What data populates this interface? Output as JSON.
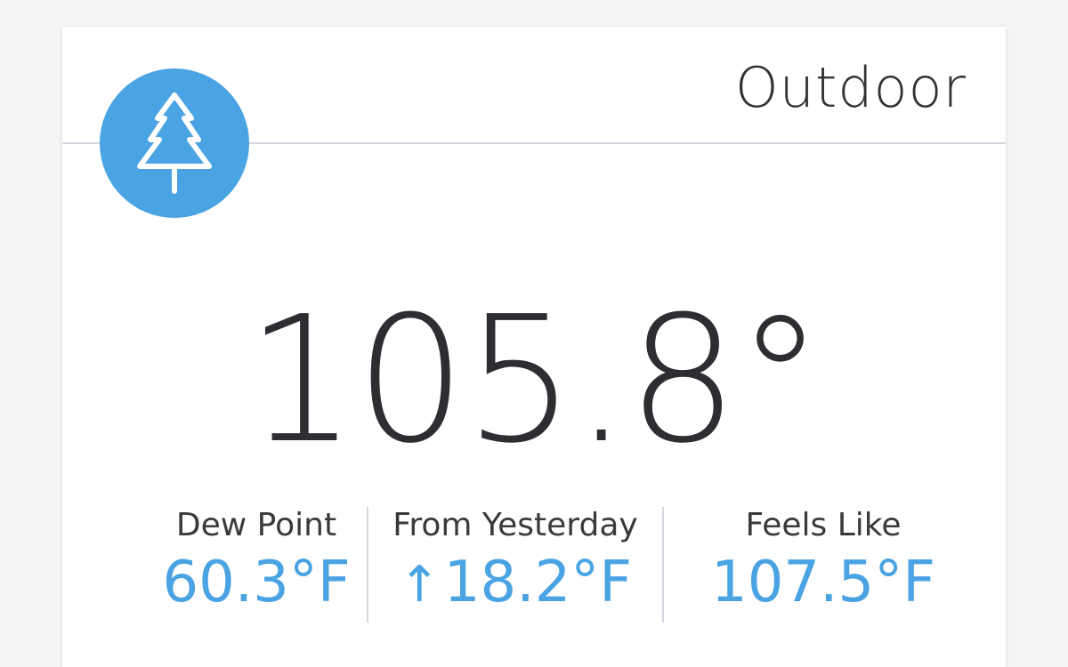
{
  "card": {
    "title": "Outdoor",
    "icon": "tree-icon",
    "accent_color": "#4aa3e2",
    "temperature": "105.8°"
  },
  "stats": [
    {
      "label": "Dew Point",
      "value": "60.3°F"
    },
    {
      "label": "From Yesterday",
      "arrow": "↑",
      "value": "18.2°F"
    },
    {
      "label": "Feels Like",
      "value": "107.5°F"
    }
  ]
}
